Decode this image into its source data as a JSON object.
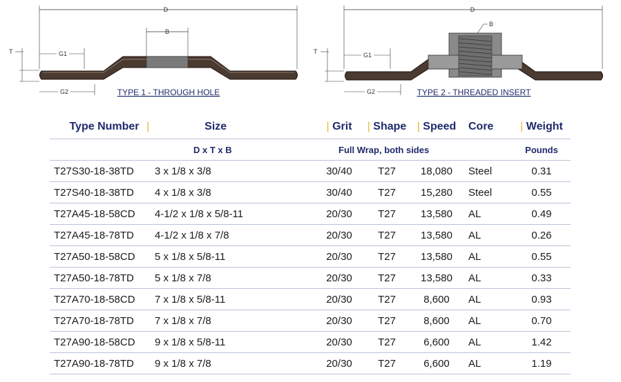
{
  "diagrams": [
    {
      "caption": "TYPE 1 - THROUGH HOLE",
      "labels": {
        "d": "D",
        "b": "B",
        "t": "T",
        "g1": "G1",
        "g2": "G2"
      }
    },
    {
      "caption": "TYPE 2 - THREADED INSERT",
      "labels": {
        "d": "D",
        "b": "B",
        "t": "T",
        "g1": "G1",
        "g2": "G2"
      }
    }
  ],
  "colors": {
    "heading": "#1f2a6b",
    "separator": "#e6b830",
    "rule": "#b9c3d6",
    "disc": "#3a2a20"
  },
  "table": {
    "headers": [
      "Type Number",
      "Size",
      "Grit",
      "Shape",
      "Speed",
      "Core",
      "Weight"
    ],
    "separator": "|",
    "subheader": {
      "size": "D x T x B",
      "grit_shape": "Full Wrap, both sides",
      "weight": "Pounds"
    },
    "rows": [
      {
        "type": "T27S30-18-38TD",
        "size": "3 x 1/8 x 3/8",
        "grit": "30/40",
        "shape": "T27",
        "speed": "18,080",
        "core": "Steel",
        "weight": "0.31"
      },
      {
        "type": "T27S40-18-38TD",
        "size": "4 x 1/8 x 3/8",
        "grit": "30/40",
        "shape": "T27",
        "speed": "15,280",
        "core": "Steel",
        "weight": "0.55"
      },
      {
        "type": "T27A45-18-58CD",
        "size": "4-1/2 x 1/8 x 5/8-11",
        "grit": "20/30",
        "shape": "T27",
        "speed": "13,580",
        "core": "AL",
        "weight": "0.49"
      },
      {
        "type": "T27A45-18-78TD",
        "size": "4-1/2 x 1/8 x 7/8",
        "grit": "20/30",
        "shape": "T27",
        "speed": "13,580",
        "core": "AL",
        "weight": "0.26"
      },
      {
        "type": "T27A50-18-58CD",
        "size": "5 x 1/8 x 5/8-11",
        "grit": "20/30",
        "shape": "T27",
        "speed": "13,580",
        "core": "AL",
        "weight": "0.55"
      },
      {
        "type": "T27A50-18-78TD",
        "size": "5 x 1/8 x 7/8",
        "grit": "20/30",
        "shape": "T27",
        "speed": "13,580",
        "core": "AL",
        "weight": "0.33"
      },
      {
        "type": "T27A70-18-58CD",
        "size": "7 x 1/8 x 5/8-11",
        "grit": "20/30",
        "shape": "T27",
        "speed": "8,600",
        "core": "AL",
        "weight": "0.93"
      },
      {
        "type": "T27A70-18-78TD",
        "size": "7 x 1/8 x 7/8",
        "grit": "20/30",
        "shape": "T27",
        "speed": "8,600",
        "core": "AL",
        "weight": "0.70"
      },
      {
        "type": "T27A90-18-58CD",
        "size": "9 x 1/8 x 5/8-11",
        "grit": "20/30",
        "shape": "T27",
        "speed": "6,600",
        "core": "AL",
        "weight": "1.42"
      },
      {
        "type": "T27A90-18-78TD",
        "size": "9 x 1/8 x 7/8",
        "grit": "20/30",
        "shape": "T27",
        "speed": "6,600",
        "core": "AL",
        "weight": "1.19"
      }
    ]
  }
}
